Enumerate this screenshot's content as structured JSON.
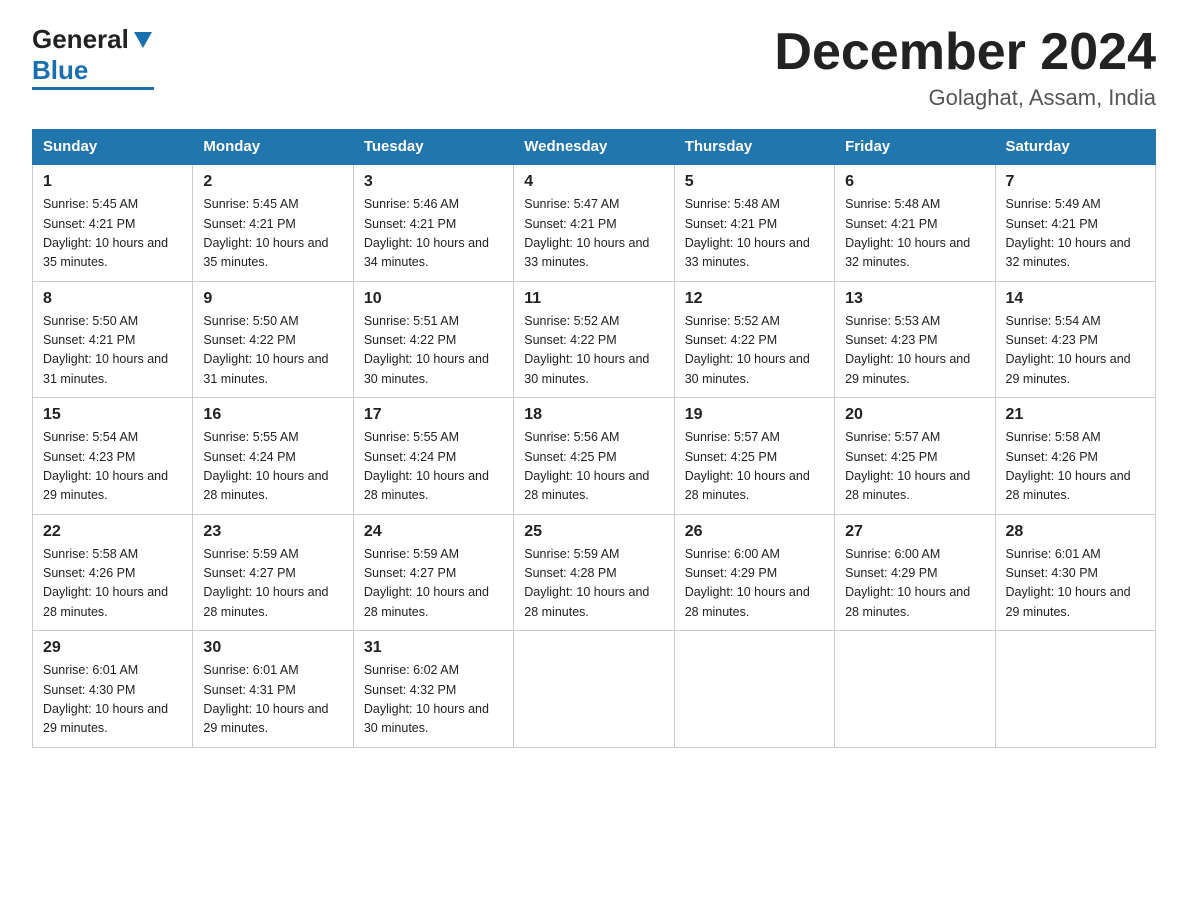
{
  "header": {
    "title": "December 2024",
    "subtitle": "Golaghat, Assam, India",
    "logo_general": "General",
    "logo_blue": "Blue"
  },
  "days_of_week": [
    "Sunday",
    "Monday",
    "Tuesday",
    "Wednesday",
    "Thursday",
    "Friday",
    "Saturday"
  ],
  "weeks": [
    [
      {
        "day": "1",
        "sunrise": "5:45 AM",
        "sunset": "4:21 PM",
        "daylight": "10 hours and 35 minutes."
      },
      {
        "day": "2",
        "sunrise": "5:45 AM",
        "sunset": "4:21 PM",
        "daylight": "10 hours and 35 minutes."
      },
      {
        "day": "3",
        "sunrise": "5:46 AM",
        "sunset": "4:21 PM",
        "daylight": "10 hours and 34 minutes."
      },
      {
        "day": "4",
        "sunrise": "5:47 AM",
        "sunset": "4:21 PM",
        "daylight": "10 hours and 33 minutes."
      },
      {
        "day": "5",
        "sunrise": "5:48 AM",
        "sunset": "4:21 PM",
        "daylight": "10 hours and 33 minutes."
      },
      {
        "day": "6",
        "sunrise": "5:48 AM",
        "sunset": "4:21 PM",
        "daylight": "10 hours and 32 minutes."
      },
      {
        "day": "7",
        "sunrise": "5:49 AM",
        "sunset": "4:21 PM",
        "daylight": "10 hours and 32 minutes."
      }
    ],
    [
      {
        "day": "8",
        "sunrise": "5:50 AM",
        "sunset": "4:21 PM",
        "daylight": "10 hours and 31 minutes."
      },
      {
        "day": "9",
        "sunrise": "5:50 AM",
        "sunset": "4:22 PM",
        "daylight": "10 hours and 31 minutes."
      },
      {
        "day": "10",
        "sunrise": "5:51 AM",
        "sunset": "4:22 PM",
        "daylight": "10 hours and 30 minutes."
      },
      {
        "day": "11",
        "sunrise": "5:52 AM",
        "sunset": "4:22 PM",
        "daylight": "10 hours and 30 minutes."
      },
      {
        "day": "12",
        "sunrise": "5:52 AM",
        "sunset": "4:22 PM",
        "daylight": "10 hours and 30 minutes."
      },
      {
        "day": "13",
        "sunrise": "5:53 AM",
        "sunset": "4:23 PM",
        "daylight": "10 hours and 29 minutes."
      },
      {
        "day": "14",
        "sunrise": "5:54 AM",
        "sunset": "4:23 PM",
        "daylight": "10 hours and 29 minutes."
      }
    ],
    [
      {
        "day": "15",
        "sunrise": "5:54 AM",
        "sunset": "4:23 PM",
        "daylight": "10 hours and 29 minutes."
      },
      {
        "day": "16",
        "sunrise": "5:55 AM",
        "sunset": "4:24 PM",
        "daylight": "10 hours and 28 minutes."
      },
      {
        "day": "17",
        "sunrise": "5:55 AM",
        "sunset": "4:24 PM",
        "daylight": "10 hours and 28 minutes."
      },
      {
        "day": "18",
        "sunrise": "5:56 AM",
        "sunset": "4:25 PM",
        "daylight": "10 hours and 28 minutes."
      },
      {
        "day": "19",
        "sunrise": "5:57 AM",
        "sunset": "4:25 PM",
        "daylight": "10 hours and 28 minutes."
      },
      {
        "day": "20",
        "sunrise": "5:57 AM",
        "sunset": "4:25 PM",
        "daylight": "10 hours and 28 minutes."
      },
      {
        "day": "21",
        "sunrise": "5:58 AM",
        "sunset": "4:26 PM",
        "daylight": "10 hours and 28 minutes."
      }
    ],
    [
      {
        "day": "22",
        "sunrise": "5:58 AM",
        "sunset": "4:26 PM",
        "daylight": "10 hours and 28 minutes."
      },
      {
        "day": "23",
        "sunrise": "5:59 AM",
        "sunset": "4:27 PM",
        "daylight": "10 hours and 28 minutes."
      },
      {
        "day": "24",
        "sunrise": "5:59 AM",
        "sunset": "4:27 PM",
        "daylight": "10 hours and 28 minutes."
      },
      {
        "day": "25",
        "sunrise": "5:59 AM",
        "sunset": "4:28 PM",
        "daylight": "10 hours and 28 minutes."
      },
      {
        "day": "26",
        "sunrise": "6:00 AM",
        "sunset": "4:29 PM",
        "daylight": "10 hours and 28 minutes."
      },
      {
        "day": "27",
        "sunrise": "6:00 AM",
        "sunset": "4:29 PM",
        "daylight": "10 hours and 28 minutes."
      },
      {
        "day": "28",
        "sunrise": "6:01 AM",
        "sunset": "4:30 PM",
        "daylight": "10 hours and 29 minutes."
      }
    ],
    [
      {
        "day": "29",
        "sunrise": "6:01 AM",
        "sunset": "4:30 PM",
        "daylight": "10 hours and 29 minutes."
      },
      {
        "day": "30",
        "sunrise": "6:01 AM",
        "sunset": "4:31 PM",
        "daylight": "10 hours and 29 minutes."
      },
      {
        "day": "31",
        "sunrise": "6:02 AM",
        "sunset": "4:32 PM",
        "daylight": "10 hours and 30 minutes."
      },
      null,
      null,
      null,
      null
    ]
  ],
  "labels": {
    "sunrise": "Sunrise:",
    "sunset": "Sunset:",
    "daylight": "Daylight:"
  }
}
